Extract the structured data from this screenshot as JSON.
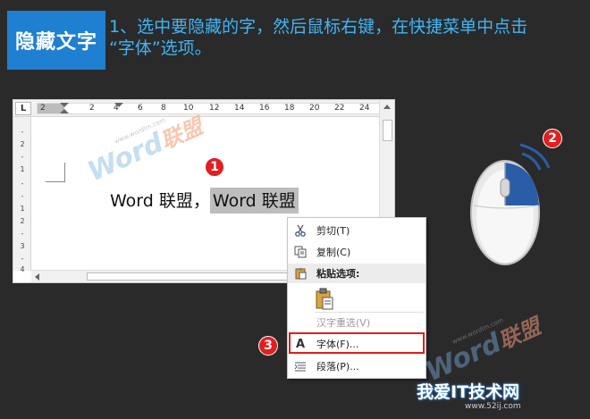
{
  "header": {
    "badge": "隐藏文字",
    "instruction_line1": "1、选中要隐藏的字，然后鼠标右键，在快捷菜单中点击",
    "instruction_line2": "“字体”选项。"
  },
  "ruler": {
    "corner": "L",
    "ticks": [
      "2",
      "2",
      "4",
      "6",
      "8",
      "10",
      "12",
      "14",
      "16",
      "18",
      "20",
      "22",
      "24"
    ],
    "vertical_ticks": [
      "-",
      "2",
      "-",
      "1",
      "-",
      "-",
      "1",
      "2",
      "-",
      "3",
      "-",
      "4"
    ]
  },
  "document": {
    "text_plain": "Word 联盟，",
    "text_selected": "Word 联盟"
  },
  "watermark": {
    "word": "Word",
    "cn": "联盟",
    "url": "www.wordlm.com"
  },
  "steps": {
    "one": "1",
    "two": "2",
    "three": "3"
  },
  "context_menu": {
    "cut": "剪切(T)",
    "copy": "复制(C)",
    "paste_options": "粘贴选项:",
    "reconvert": "汉字重选(V)",
    "font": "字体(F)...",
    "paragraph": "段落(P)..."
  },
  "icons": {
    "cut": "scissors-icon",
    "copy": "copy-icon",
    "paste": "clipboard-icon",
    "font": "font-icon",
    "paragraph": "paragraph-icon"
  },
  "colors": {
    "badge_bg": "#1f7fd1",
    "instruction_text": "#3fb6f5",
    "step_badge": "#e02020",
    "highlight_border": "#e21b1b",
    "mouse_accent": "#2a5da8"
  },
  "footer": {
    "site_logo": "我爱IT技术网",
    "site_url": "www.52ij.com"
  }
}
